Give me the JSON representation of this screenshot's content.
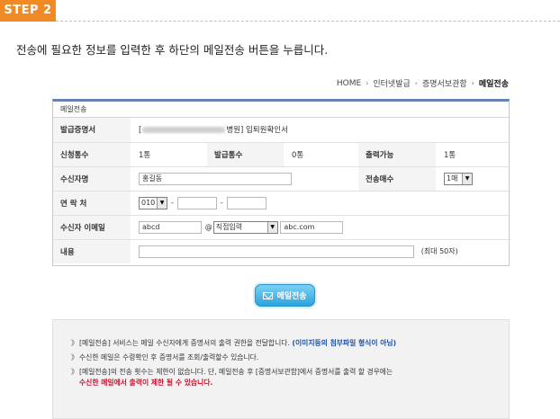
{
  "step": {
    "label": "STEP 2"
  },
  "intro": "전송에 필요한 정보를 입력한 후 하단의 메일전송 버튼을 누릅니다.",
  "breadcrumb": {
    "items": [
      "HOME",
      "인터넷발급",
      "증명서보관함"
    ],
    "current": "메일전송"
  },
  "panel": {
    "title": "메일전송",
    "cert_label": "발급증명서",
    "cert_prefix": "[",
    "cert_hospital_suffix": "병원]",
    "cert_name": "입퇴원확인서",
    "apply_count_label": "신청통수",
    "apply_count": "1통",
    "issue_count_label": "발급통수",
    "issue_count": "0통",
    "print_avail_label": "출력가능",
    "print_avail": "1통",
    "recipient_name_label": "수신자명",
    "recipient_name": "홍길동",
    "send_count_label": "전송매수",
    "send_count_value": "1매",
    "contact_label": "연 락 처",
    "phone_prefix": "010",
    "phone_sep": "-",
    "email_label": "수신자 이메일",
    "email_id": "abcd",
    "email_at": "@",
    "email_domain_select": "직접입력",
    "email_domain": "abc.com",
    "content_label": "내용",
    "content_note": "(최대 50자)"
  },
  "send_button": {
    "label": "메일전송"
  },
  "info": {
    "bullet": "》",
    "line1_text": "[메일전송] 서비스는 메일 수신자에게 증명서의 출력 권한을 전달합니다.",
    "line1_highlight": "(이미지등의 첨부파일 형식이 아님)",
    "line2_text": "수신한 메일은 수령확인 후 증명서를 조회/출력할수 있습니다.",
    "line3_text": "[메일전송]의 전송 횟수는 제한이 없습니다. 단, 메일전송 후 [증명서보관함]에서 증명서를 출력 할 경우에는",
    "line3_highlight": "수신한 메일에서 출력이 제한 될 수 있습니다."
  },
  "colors": {
    "step_orange": "#f08a24",
    "panel_top_border": "#6a7fb8",
    "button_blue": "#2aa4de",
    "highlight_blue": "#1d4fa3",
    "highlight_red": "#c8102e"
  }
}
